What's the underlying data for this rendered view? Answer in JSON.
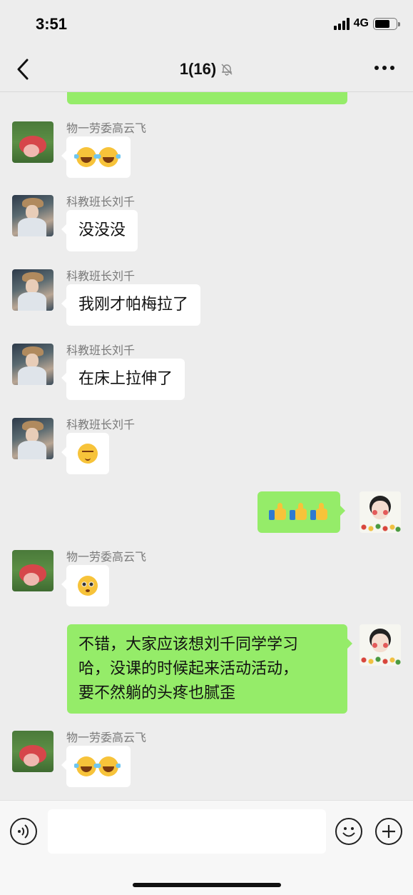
{
  "status_bar": {
    "time": "3:51",
    "network": "4G"
  },
  "nav": {
    "title": "1(16)"
  },
  "messages": [
    {
      "sender": "物一劳委高云飞",
      "type": "emoji",
      "emojis": [
        "laugh-cry",
        "laugh-cry"
      ],
      "mine": false
    },
    {
      "sender": "科教班长刘千",
      "type": "text",
      "text": "没没没",
      "mine": false
    },
    {
      "sender": "科教班长刘千",
      "type": "text",
      "text": "我刚才帕梅拉了",
      "mine": false
    },
    {
      "sender": "科教班长刘千",
      "type": "text",
      "text": "在床上拉伸了",
      "mine": false
    },
    {
      "sender": "科教班长刘千",
      "type": "emoji",
      "emojis": [
        "relieved"
      ],
      "mine": false
    },
    {
      "sender": "",
      "type": "emoji",
      "emojis": [
        "thumbs-up",
        "thumbs-up",
        "thumbs-up"
      ],
      "mine": true
    },
    {
      "sender": "物一劳委高云飞",
      "type": "emoji",
      "emojis": [
        "flushed"
      ],
      "mine": false
    },
    {
      "sender": "",
      "type": "text",
      "text": "不错，大家应该想刘千同学学习哈，没课的时候起来活动活动，要不然躺的头疼也腻歪",
      "lines": [
        "不错，大家应该想刘千同学学习",
        "哈，没课的时候起来活动活动，",
        "要不然躺的头疼也腻歪"
      ],
      "mine": true
    },
    {
      "sender": "物一劳委高云飞",
      "type": "emoji",
      "emojis": [
        "laugh-cry",
        "laugh-cry"
      ],
      "mine": false
    }
  ],
  "input": {
    "value": "",
    "placeholder": ""
  },
  "colors": {
    "background": "#ededed",
    "my_bubble": "#95ec69",
    "their_bubble": "#ffffff",
    "sender_name": "#7a7a7a"
  }
}
